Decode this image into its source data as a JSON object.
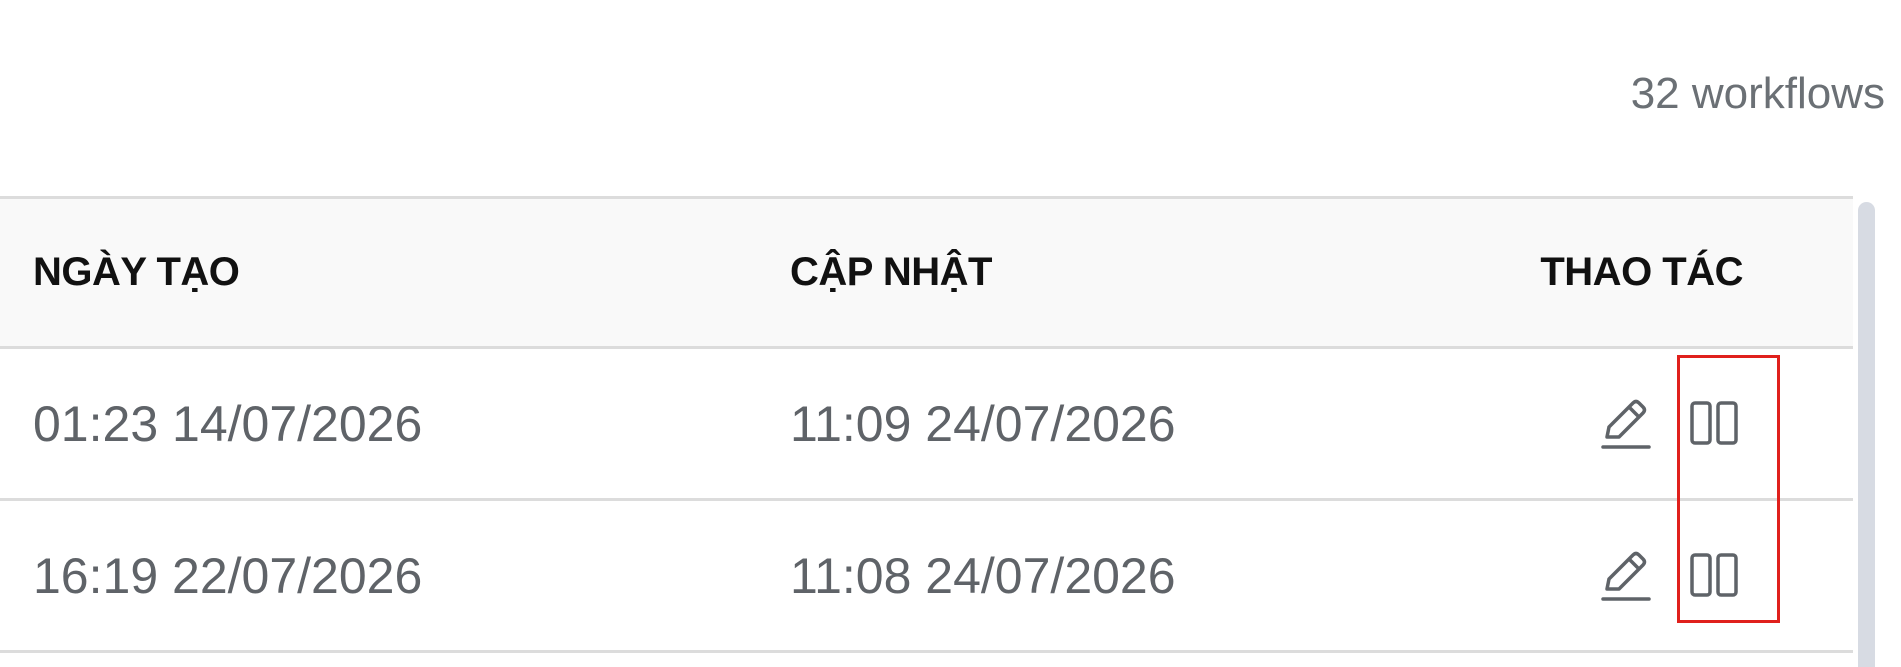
{
  "summary": {
    "workflow_count_label": "32 workflows"
  },
  "table": {
    "headers": {
      "created": "NGÀY TẠO",
      "updated": "CẬP NHẬT",
      "actions": "THAO TÁC"
    },
    "rows": [
      {
        "created": "01:23 14/07/2026",
        "updated": "11:09 24/07/2026"
      },
      {
        "created": "16:19 22/07/2026",
        "updated": "11:08 24/07/2026"
      }
    ]
  },
  "icons": {
    "edit": "pencil-icon",
    "columns": "columns-icon"
  },
  "colors": {
    "text_muted": "#5f6368",
    "header_bg": "#f9f9f9",
    "border": "#dcdcdc",
    "highlight": "#e0201c",
    "scrollbar": "#d7dbe3"
  }
}
